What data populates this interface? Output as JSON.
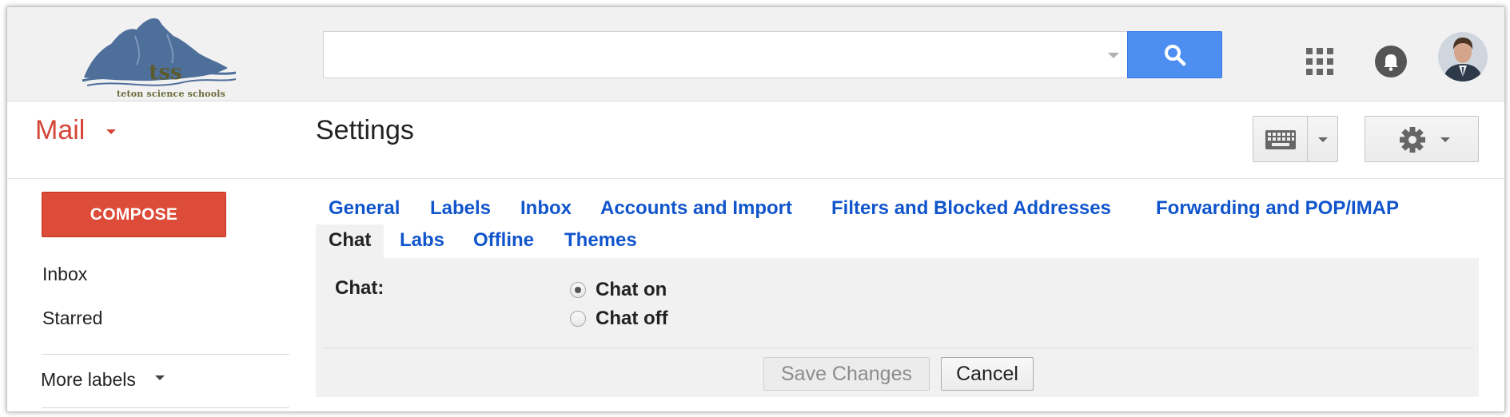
{
  "logo": {
    "title": "tss",
    "subtitle": "teton science schools"
  },
  "search": {
    "value": "",
    "placeholder": ""
  },
  "icons": {
    "search": "search-icon",
    "apps": "apps-grid-icon",
    "notifications": "bell-icon",
    "keyboard": "keyboard-icon",
    "settings": "gear-icon"
  },
  "header": {
    "app_label": "Mail",
    "page_title": "Settings"
  },
  "sidebar": {
    "compose_label": "COMPOSE",
    "items": [
      {
        "label": "Inbox"
      },
      {
        "label": "Starred"
      }
    ],
    "more_label": "More labels"
  },
  "tabs": [
    {
      "label": "General",
      "active": false
    },
    {
      "label": "Labels",
      "active": false
    },
    {
      "label": "Inbox",
      "active": false
    },
    {
      "label": "Accounts and Import",
      "active": false
    },
    {
      "label": "Filters and Blocked Addresses",
      "active": false
    },
    {
      "label": "Forwarding and POP/IMAP",
      "active": false
    },
    {
      "label": "Chat",
      "active": true
    },
    {
      "label": "Labs",
      "active": false
    },
    {
      "label": "Offline",
      "active": false
    },
    {
      "label": "Themes",
      "active": false
    }
  ],
  "settings": {
    "field_label": "Chat:",
    "options": [
      {
        "label": "Chat on",
        "checked": true
      },
      {
        "label": "Chat off",
        "checked": false
      }
    ],
    "save_label": "Save Changes",
    "cancel_label": "Cancel"
  },
  "colors": {
    "brand_red": "#dd4b39",
    "link_blue": "#1155cc",
    "search_blue": "#4d8ff1"
  }
}
